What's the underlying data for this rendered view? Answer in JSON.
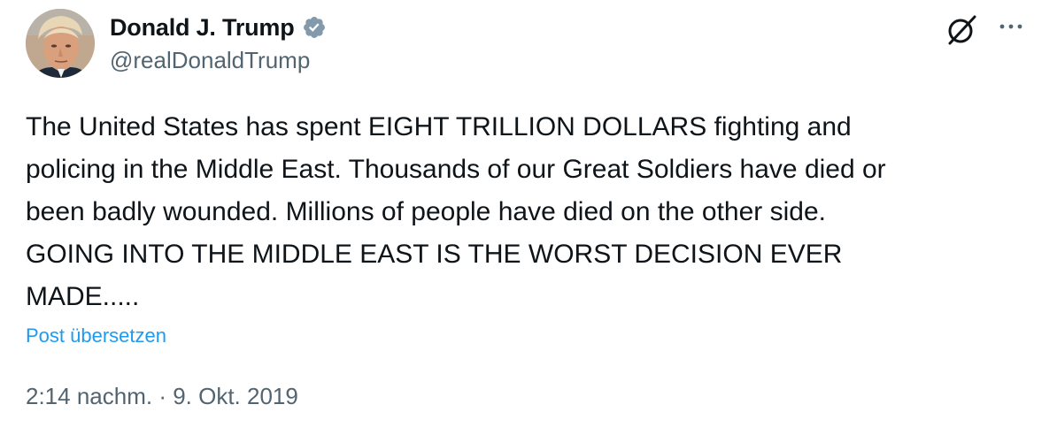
{
  "author": {
    "display_name": "Donald J. Trump",
    "handle": "@realDonaldTrump",
    "verified": true
  },
  "tweet": {
    "text": "The United States has spent EIGHT TRILLION DOLLARS fighting and\npolicing in the Middle East. Thousands of our Great Soldiers have died or\nbeen badly wounded. Millions of people have died on the other side.\nGOING INTO THE MIDDLE EAST IS THE WORST DECISION EVER\nMADE.....",
    "translate_label": "Post übersetzen",
    "timestamp": "2:14 nachm. · 9. Okt. 2019"
  },
  "icons": {
    "verified": "verified-badge-icon",
    "grok": "grok-icon",
    "more": "more-options-icon"
  },
  "colors": {
    "accent": "#1d9bf0",
    "secondary_text": "#536471",
    "primary_text": "#0f1419",
    "verified_badge": "#829aab"
  }
}
